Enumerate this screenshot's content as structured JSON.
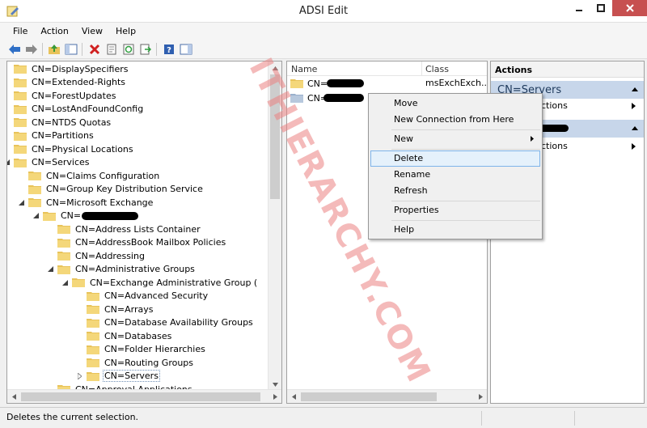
{
  "window": {
    "title": "ADSI Edit"
  },
  "menu": [
    "File",
    "Action",
    "View",
    "Help"
  ],
  "tree": [
    {
      "label": "CN=DisplaySpecifiers",
      "level": 3,
      "expander": "none"
    },
    {
      "label": "CN=Extended-Rights",
      "level": 3,
      "expander": "none"
    },
    {
      "label": "CN=ForestUpdates",
      "level": 3,
      "expander": "none"
    },
    {
      "label": "CN=LostAndFoundConfig",
      "level": 3,
      "expander": "none"
    },
    {
      "label": "CN=NTDS Quotas",
      "level": 3,
      "expander": "none"
    },
    {
      "label": "CN=Partitions",
      "level": 3,
      "expander": "none"
    },
    {
      "label": "CN=Physical Locations",
      "level": 3,
      "expander": "none"
    },
    {
      "label": "CN=Services",
      "level": 3,
      "expander": "expanded"
    },
    {
      "label": "CN=Claims Configuration",
      "level": 4,
      "expander": "none"
    },
    {
      "label": "CN=Group Key Distribution Service",
      "level": 4,
      "expander": "none"
    },
    {
      "label": "CN=Microsoft Exchange",
      "level": 4,
      "expander": "expanded"
    },
    {
      "label": "CN=",
      "level": 5,
      "expander": "expanded",
      "redacted": true
    },
    {
      "label": "CN=Address Lists Container",
      "level": 6,
      "expander": "none"
    },
    {
      "label": "CN=AddressBook Mailbox Policies",
      "level": 6,
      "expander": "none"
    },
    {
      "label": "CN=Addressing",
      "level": 6,
      "expander": "none"
    },
    {
      "label": "CN=Administrative Groups",
      "level": 6,
      "expander": "expanded"
    },
    {
      "label": "CN=Exchange Administrative Group (",
      "level": 7,
      "expander": "expanded"
    },
    {
      "label": "CN=Advanced Security",
      "level": 8,
      "expander": "none"
    },
    {
      "label": "CN=Arrays",
      "level": 8,
      "expander": "none"
    },
    {
      "label": "CN=Database Availability Groups",
      "level": 8,
      "expander": "none"
    },
    {
      "label": "CN=Databases",
      "level": 8,
      "expander": "none"
    },
    {
      "label": "CN=Folder Hierarchies",
      "level": 8,
      "expander": "none"
    },
    {
      "label": "CN=Routing Groups",
      "level": 8,
      "expander": "none"
    },
    {
      "label": "CN=Servers",
      "level": 8,
      "expander": "collapsed",
      "selected": true
    },
    {
      "label": "CN=Approval Applications",
      "level": 6,
      "expander": "none"
    }
  ],
  "list": {
    "columns": [
      "Name",
      "Class"
    ],
    "rows": [
      {
        "name": "CN=",
        "class": "msExchExch...",
        "redacted": true,
        "selected": false
      },
      {
        "name": "CN=",
        "class": "",
        "redacted": true,
        "selected": true
      }
    ]
  },
  "actions": {
    "title": "Actions",
    "group1": "CN=Servers",
    "group1_item": "ctions",
    "group2_item": "ctions"
  },
  "context_menu": {
    "items": [
      "Move",
      "New Connection from Here",
      "New",
      "Delete",
      "Rename",
      "Refresh",
      "Properties",
      "Help"
    ],
    "highlighted": "Delete"
  },
  "status": {
    "text": "Deletes the current selection."
  },
  "watermark": "ITHIERARCHY.COM",
  "colors": {
    "selection": "#3399ff",
    "group_header": "#c7d6ea",
    "menu_highlight": "#e5f1fb",
    "close_button": "#c75050"
  }
}
